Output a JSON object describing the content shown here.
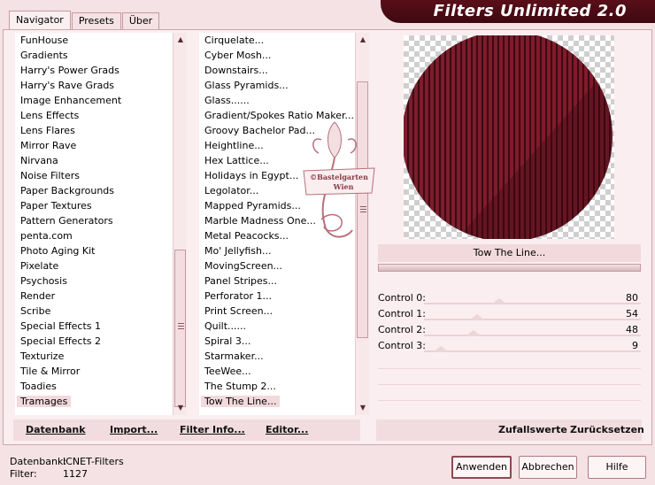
{
  "title": "Filters Unlimited 2.0",
  "tabs": [
    {
      "label": "Navigator",
      "active": true
    },
    {
      "label": "Presets",
      "active": false
    },
    {
      "label": "Über",
      "active": false
    }
  ],
  "categories": [
    "FunHouse",
    "Gradients",
    "Harry's Power Grads",
    "Harry's Rave Grads",
    "Image Enhancement",
    "Lens Effects",
    "Lens Flares",
    "Mirror Rave",
    "Nirvana",
    "Noise Filters",
    "Paper Backgrounds",
    "Paper Textures",
    "Pattern Generators",
    "penta.com",
    "Photo Aging Kit",
    "Pixelate",
    "Psychosis",
    "Render",
    "Scribe",
    "Special Effects 1",
    "Special Effects 2",
    "Texturize",
    "Tile & Mirror",
    "Toadies",
    "Tramages"
  ],
  "categories_selected_index": 24,
  "filters": [
    "Cirquelate...",
    "Cyber Mosh...",
    "Downstairs...",
    "Glass Pyramids...",
    "Glass......",
    "Gradient/Spokes Ratio Maker...",
    "Groovy Bachelor Pad...",
    "Heightline...",
    "Hex Lattice...",
    "Holidays in Egypt...",
    "Legolator...",
    "Mapped Pyramids...",
    "Marble Madness One...",
    "Metal Peacocks...",
    "Mo' Jellyfish...",
    "MovingScreen...",
    "Panel Stripes...",
    "Perforator 1...",
    "Print Screen...",
    "Quilt......",
    "Spiral 3...",
    "Starmaker...",
    "TeeWee...",
    "The Stump 2...",
    "Tow The Line..."
  ],
  "filters_selected_index": 24,
  "logo": {
    "line1": "©Bastelgarten",
    "line2": "Wien"
  },
  "preview": {
    "stripe_color": "#7d1d2c",
    "stripe_dark": "#3a0a12"
  },
  "current_filter": "Tow The Line...",
  "controls": [
    {
      "label": "Control 0:",
      "value": "80",
      "level": 0.31
    },
    {
      "label": "Control 1:",
      "value": "54",
      "level": 0.21
    },
    {
      "label": "Control 2:",
      "value": "48",
      "level": 0.19
    },
    {
      "label": "Control 3:",
      "value": "9",
      "level": 0.04
    }
  ],
  "toolbar": {
    "datenbank": "Datenbank",
    "import": "Import...",
    "filter_info": "Filter Info...",
    "editor": "Editor..."
  },
  "toolbar_right": {
    "zufallswerte": "Zufallswerte",
    "zuruecksetzen": "Zurücksetzen"
  },
  "status": {
    "db_label": "Datenbank:",
    "db_value": "ICNET-Filters",
    "filter_label": "Filter:",
    "filter_value": "1127"
  },
  "buttons": {
    "anwenden": "Anwenden",
    "abbrechen": "Abbrechen",
    "hilfe": "Hilfe"
  }
}
